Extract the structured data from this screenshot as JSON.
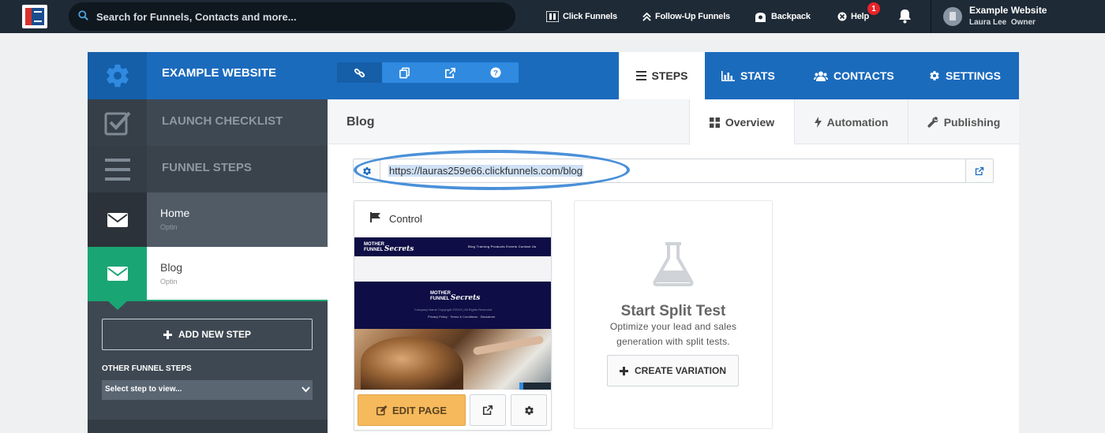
{
  "topbar": {
    "search_placeholder": "Search for Funnels, Contacts and more...",
    "nav": {
      "clickfunnels": "Click Funnels",
      "followup": "Follow-Up Funnels",
      "backpack": "Backpack",
      "help": "Help"
    },
    "help_badge": "1",
    "account": {
      "name": "Example Website",
      "user": "Laura Lee",
      "role": "Owner"
    }
  },
  "header": {
    "funnel_title": "EXAMPLE WEBSITE",
    "tabs": {
      "steps": "STEPS",
      "stats": "STATS",
      "contacts": "CONTACTS",
      "settings": "SETTINGS"
    }
  },
  "sidebar": {
    "launch_checklist": "LAUNCH CHECKLIST",
    "funnel_steps": "FUNNEL STEPS",
    "steps": [
      {
        "name": "Home",
        "type": "Optin"
      },
      {
        "name": "Blog",
        "type": "Optin"
      }
    ],
    "add_step": "ADD NEW STEP",
    "other_steps_label": "OTHER FUNNEL STEPS",
    "select_value": "Select step to view..."
  },
  "content": {
    "step_title": "Blog",
    "subtabs": {
      "overview": "Overview",
      "automation": "Automation",
      "publishing": "Publishing"
    },
    "url": "https://lauras259e66.clickfunnels.com/blog",
    "variant": {
      "label": "Control",
      "edit_button": "EDIT PAGE",
      "thumb": {
        "logo_top": "MOTHER",
        "logo_mid": "FUNNEL",
        "logo_script": "Secrets",
        "nav_links": "Blog    Training    Products    Events    Contact Us",
        "footer": "Company Name Copyright ©2019 | All Rights Reserved",
        "footer_links": "Privacy Policy  ·  Terms & Conditions  ·  Disclaimer"
      }
    },
    "split_test": {
      "heading": "Start Split Test",
      "desc_line1": "Optimize your lead and sales",
      "desc_line2": "generation with split tests.",
      "button": "CREATE VARIATION"
    }
  },
  "colors": {
    "topbar": "#1e2a36",
    "header_blue": "#1b6bbd",
    "sidebar": "#3e4852",
    "active_green": "#1aa574",
    "edit_orange": "#f6b95c",
    "highlight_oval": "#4a90d9"
  },
  "icons": [
    "search-icon",
    "clickfunnels-icon",
    "followup-icon",
    "backpack-icon",
    "help-icon",
    "bell-icon",
    "gear-icon",
    "link-icon",
    "copy-icon",
    "external-link-icon",
    "question-icon",
    "list-icon",
    "bar-chart-icon",
    "users-icon",
    "checkbox-icon",
    "bars-icon",
    "envelope-icon",
    "plus-icon",
    "chevron-down-icon",
    "grid-icon",
    "bolt-icon",
    "wrench-icon",
    "flag-icon",
    "pencil-icon",
    "flask-icon"
  ]
}
